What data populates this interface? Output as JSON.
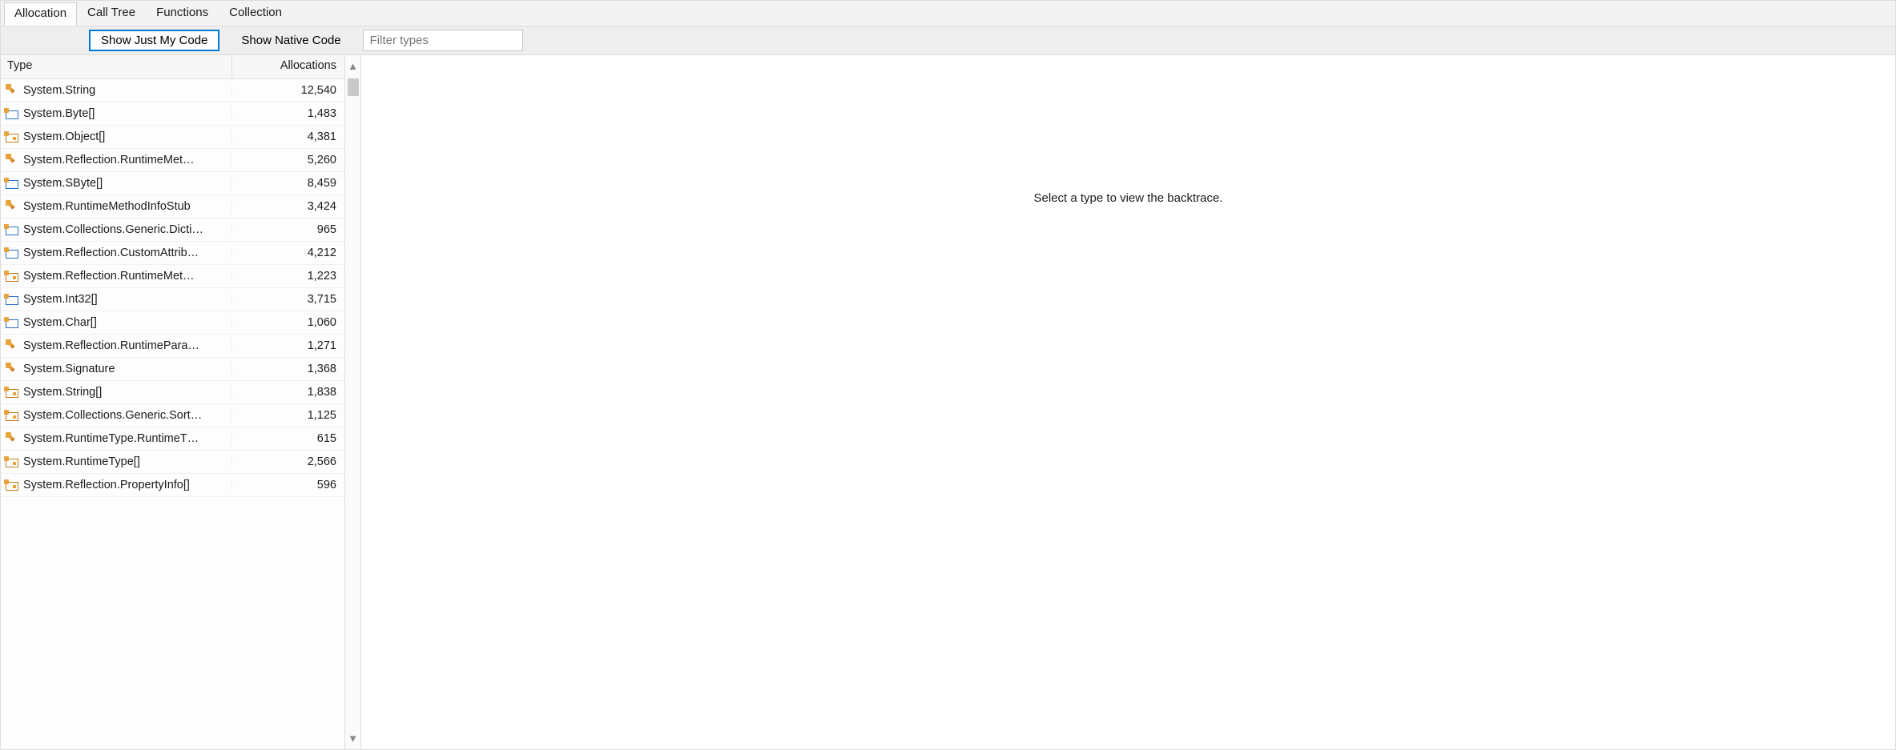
{
  "tabs": {
    "allocation": "Allocation",
    "calltree": "Call Tree",
    "functions": "Functions",
    "collection": "Collection"
  },
  "toolbar": {
    "show_just_my_code": "Show Just My Code",
    "show_native_code": "Show Native Code",
    "filter_placeholder": "Filter types"
  },
  "grid": {
    "headers": {
      "type": "Type",
      "allocations": "Allocations"
    },
    "rows": [
      {
        "icon": "class",
        "type": "System.String",
        "allocations": "12,540"
      },
      {
        "icon": "struct",
        "type": "System.Byte[]",
        "allocations": "1,483"
      },
      {
        "icon": "array",
        "type": "System.Object[]",
        "allocations": "4,381"
      },
      {
        "icon": "class",
        "type": "System.Reflection.RuntimeMet…",
        "allocations": "5,260"
      },
      {
        "icon": "struct",
        "type": "System.SByte[]",
        "allocations": "8,459"
      },
      {
        "icon": "class",
        "type": "System.RuntimeMethodInfoStub",
        "allocations": "3,424"
      },
      {
        "icon": "struct",
        "type": "System.Collections.Generic.Dicti…",
        "allocations": "965"
      },
      {
        "icon": "struct",
        "type": "System.Reflection.CustomAttrib…",
        "allocations": "4,212"
      },
      {
        "icon": "array",
        "type": "System.Reflection.RuntimeMet…",
        "allocations": "1,223"
      },
      {
        "icon": "struct",
        "type": "System.Int32[]",
        "allocations": "3,715"
      },
      {
        "icon": "struct",
        "type": "System.Char[]",
        "allocations": "1,060"
      },
      {
        "icon": "class",
        "type": "System.Reflection.RuntimePara…",
        "allocations": "1,271"
      },
      {
        "icon": "class",
        "type": "System.Signature",
        "allocations": "1,368"
      },
      {
        "icon": "array",
        "type": "System.String[]",
        "allocations": "1,838"
      },
      {
        "icon": "array",
        "type": "System.Collections.Generic.Sort…",
        "allocations": "1,125"
      },
      {
        "icon": "class",
        "type": "System.RuntimeType.RuntimeT…",
        "allocations": "615"
      },
      {
        "icon": "array",
        "type": "System.RuntimeType[]",
        "allocations": "2,566"
      },
      {
        "icon": "array",
        "type": "System.Reflection.PropertyInfo[]",
        "allocations": "596"
      }
    ]
  },
  "detail": {
    "empty_message": "Select a type to view the backtrace."
  }
}
